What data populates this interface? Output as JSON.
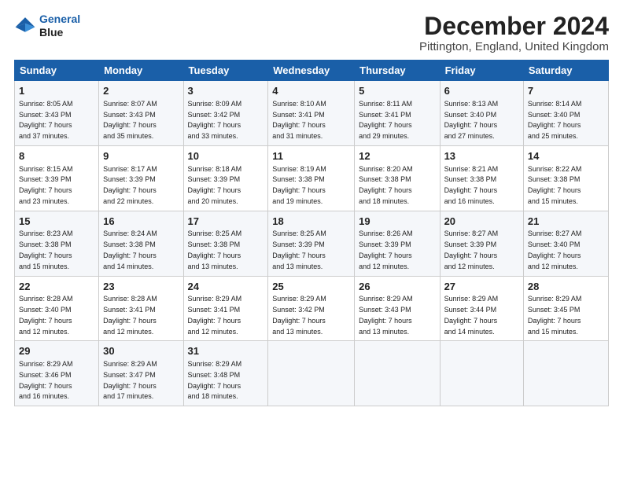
{
  "header": {
    "logo_line1": "General",
    "logo_line2": "Blue",
    "month_title": "December 2024",
    "location": "Pittington, England, United Kingdom"
  },
  "days_of_week": [
    "Sunday",
    "Monday",
    "Tuesday",
    "Wednesday",
    "Thursday",
    "Friday",
    "Saturday"
  ],
  "weeks": [
    [
      {
        "day": "1",
        "info": "Sunrise: 8:05 AM\nSunset: 3:43 PM\nDaylight: 7 hours\nand 37 minutes."
      },
      {
        "day": "2",
        "info": "Sunrise: 8:07 AM\nSunset: 3:43 PM\nDaylight: 7 hours\nand 35 minutes."
      },
      {
        "day": "3",
        "info": "Sunrise: 8:09 AM\nSunset: 3:42 PM\nDaylight: 7 hours\nand 33 minutes."
      },
      {
        "day": "4",
        "info": "Sunrise: 8:10 AM\nSunset: 3:41 PM\nDaylight: 7 hours\nand 31 minutes."
      },
      {
        "day": "5",
        "info": "Sunrise: 8:11 AM\nSunset: 3:41 PM\nDaylight: 7 hours\nand 29 minutes."
      },
      {
        "day": "6",
        "info": "Sunrise: 8:13 AM\nSunset: 3:40 PM\nDaylight: 7 hours\nand 27 minutes."
      },
      {
        "day": "7",
        "info": "Sunrise: 8:14 AM\nSunset: 3:40 PM\nDaylight: 7 hours\nand 25 minutes."
      }
    ],
    [
      {
        "day": "8",
        "info": "Sunrise: 8:15 AM\nSunset: 3:39 PM\nDaylight: 7 hours\nand 23 minutes."
      },
      {
        "day": "9",
        "info": "Sunrise: 8:17 AM\nSunset: 3:39 PM\nDaylight: 7 hours\nand 22 minutes."
      },
      {
        "day": "10",
        "info": "Sunrise: 8:18 AM\nSunset: 3:39 PM\nDaylight: 7 hours\nand 20 minutes."
      },
      {
        "day": "11",
        "info": "Sunrise: 8:19 AM\nSunset: 3:38 PM\nDaylight: 7 hours\nand 19 minutes."
      },
      {
        "day": "12",
        "info": "Sunrise: 8:20 AM\nSunset: 3:38 PM\nDaylight: 7 hours\nand 18 minutes."
      },
      {
        "day": "13",
        "info": "Sunrise: 8:21 AM\nSunset: 3:38 PM\nDaylight: 7 hours\nand 16 minutes."
      },
      {
        "day": "14",
        "info": "Sunrise: 8:22 AM\nSunset: 3:38 PM\nDaylight: 7 hours\nand 15 minutes."
      }
    ],
    [
      {
        "day": "15",
        "info": "Sunrise: 8:23 AM\nSunset: 3:38 PM\nDaylight: 7 hours\nand 15 minutes."
      },
      {
        "day": "16",
        "info": "Sunrise: 8:24 AM\nSunset: 3:38 PM\nDaylight: 7 hours\nand 14 minutes."
      },
      {
        "day": "17",
        "info": "Sunrise: 8:25 AM\nSunset: 3:38 PM\nDaylight: 7 hours\nand 13 minutes."
      },
      {
        "day": "18",
        "info": "Sunrise: 8:25 AM\nSunset: 3:39 PM\nDaylight: 7 hours\nand 13 minutes."
      },
      {
        "day": "19",
        "info": "Sunrise: 8:26 AM\nSunset: 3:39 PM\nDaylight: 7 hours\nand 12 minutes."
      },
      {
        "day": "20",
        "info": "Sunrise: 8:27 AM\nSunset: 3:39 PM\nDaylight: 7 hours\nand 12 minutes."
      },
      {
        "day": "21",
        "info": "Sunrise: 8:27 AM\nSunset: 3:40 PM\nDaylight: 7 hours\nand 12 minutes."
      }
    ],
    [
      {
        "day": "22",
        "info": "Sunrise: 8:28 AM\nSunset: 3:40 PM\nDaylight: 7 hours\nand 12 minutes."
      },
      {
        "day": "23",
        "info": "Sunrise: 8:28 AM\nSunset: 3:41 PM\nDaylight: 7 hours\nand 12 minutes."
      },
      {
        "day": "24",
        "info": "Sunrise: 8:29 AM\nSunset: 3:41 PM\nDaylight: 7 hours\nand 12 minutes."
      },
      {
        "day": "25",
        "info": "Sunrise: 8:29 AM\nSunset: 3:42 PM\nDaylight: 7 hours\nand 13 minutes."
      },
      {
        "day": "26",
        "info": "Sunrise: 8:29 AM\nSunset: 3:43 PM\nDaylight: 7 hours\nand 13 minutes."
      },
      {
        "day": "27",
        "info": "Sunrise: 8:29 AM\nSunset: 3:44 PM\nDaylight: 7 hours\nand 14 minutes."
      },
      {
        "day": "28",
        "info": "Sunrise: 8:29 AM\nSunset: 3:45 PM\nDaylight: 7 hours\nand 15 minutes."
      }
    ],
    [
      {
        "day": "29",
        "info": "Sunrise: 8:29 AM\nSunset: 3:46 PM\nDaylight: 7 hours\nand 16 minutes."
      },
      {
        "day": "30",
        "info": "Sunrise: 8:29 AM\nSunset: 3:47 PM\nDaylight: 7 hours\nand 17 minutes."
      },
      {
        "day": "31",
        "info": "Sunrise: 8:29 AM\nSunset: 3:48 PM\nDaylight: 7 hours\nand 18 minutes."
      },
      null,
      null,
      null,
      null
    ]
  ]
}
